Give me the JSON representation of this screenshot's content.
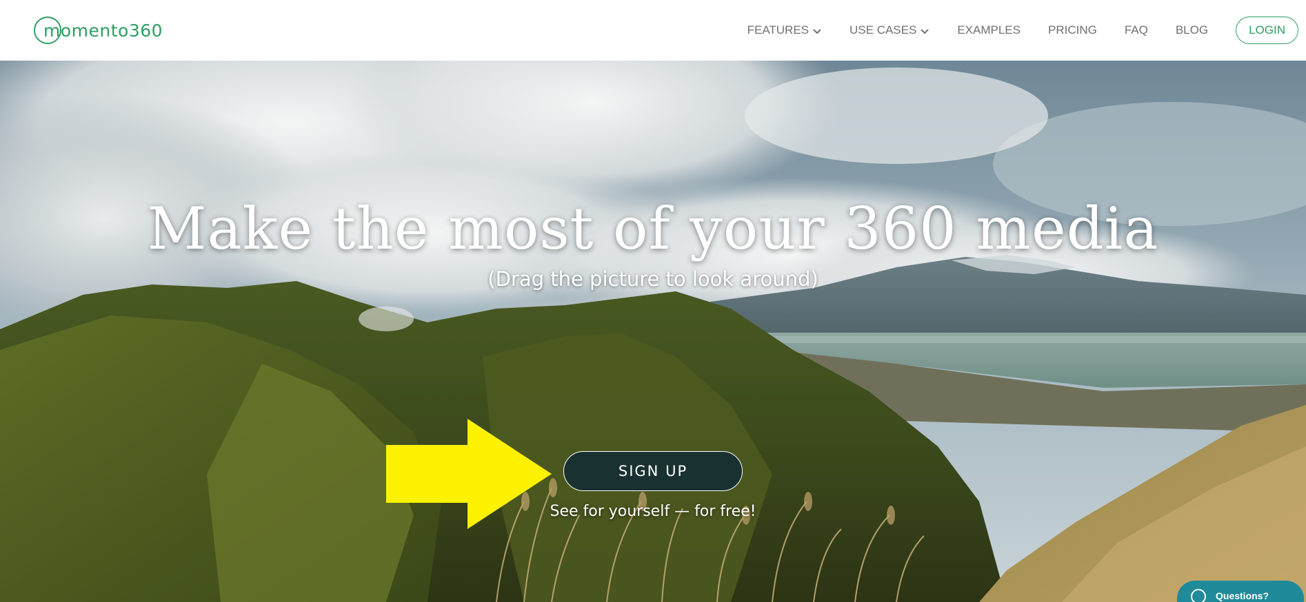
{
  "header": {
    "logo_text": "momento360",
    "nav": [
      {
        "label": "FEATURES",
        "dropdown": true
      },
      {
        "label": "USE CASES",
        "dropdown": true
      },
      {
        "label": "EXAMPLES",
        "dropdown": false
      },
      {
        "label": "PRICING",
        "dropdown": false
      },
      {
        "label": "FAQ",
        "dropdown": false
      },
      {
        "label": "BLOG",
        "dropdown": false
      }
    ],
    "login_label": "LOGIN"
  },
  "hero": {
    "title": "Make the most of your 360 media",
    "subtitle": "(Drag the picture to look around)",
    "signup_label": "SIGN UP",
    "signup_note": "See for yourself — for free!"
  },
  "chat_widget": {
    "label": "Questions?"
  },
  "colors": {
    "brand_green": "#2e9e62",
    "nav_text": "#707070",
    "arrow_yellow": "#fff200",
    "chat_teal": "#1f8a9a"
  },
  "icons": {
    "dropdown": "chevron-down-icon",
    "chat": "chat-bubble-icon",
    "arrow": "arrow-right-icon"
  }
}
